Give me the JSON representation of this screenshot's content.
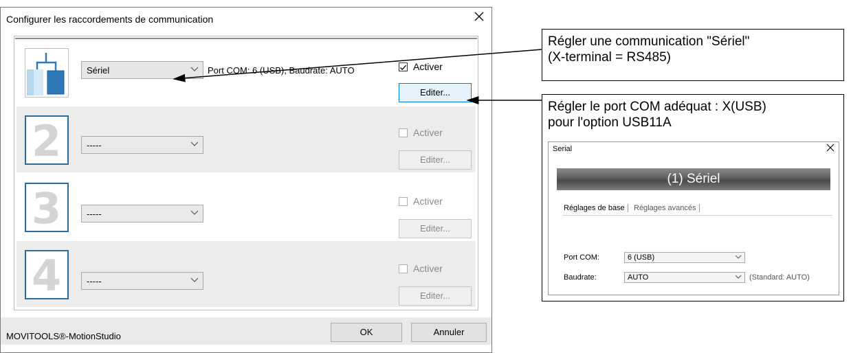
{
  "dialog": {
    "title": "Configurer les raccordements de communication",
    "close_glyph": "×",
    "rows": [
      {
        "number": "1",
        "select_value": "Sériel",
        "port_info": "Port COM: 6 (USB), Baudrate: AUTO",
        "activate_label": "Activer",
        "activate_checked": true,
        "edit_label": "Editer..."
      },
      {
        "number": "2",
        "select_value": "-----",
        "activate_label": "Activer",
        "activate_checked": false,
        "edit_label": "Editer..."
      },
      {
        "number": "3",
        "select_value": "-----",
        "activate_label": "Activer",
        "activate_checked": false,
        "edit_label": "Editer..."
      },
      {
        "number": "4",
        "select_value": "-----",
        "activate_label": "Activer",
        "activate_checked": false,
        "edit_label": "Editer..."
      }
    ],
    "footer": {
      "brand": "MOVITOOLS®-MotionStudio",
      "ok_label": "OK",
      "cancel_label": "Annuler"
    }
  },
  "callouts": {
    "serial": {
      "line1": "Régler une communication \"Sériel\"",
      "line2": "(X-terminal = RS485)"
    },
    "port": {
      "line1": "Régler le port COM adéquat : X(USB)",
      "line2": "pour l'option USB11A"
    }
  },
  "serial_window": {
    "title": "Serial",
    "banner": "(1) Sériel",
    "tabs": [
      "Réglages de base",
      "Réglages avancés"
    ],
    "port_label": "Port COM:",
    "port_value": "6 (USB)",
    "baud_label": "Baudrate:",
    "baud_value": "AUTO",
    "baud_hint": "(Standard: AUTO)"
  },
  "icons": {
    "close": "close-icon",
    "dropdown": "chevron-down-icon",
    "checkbox": "checkmark-icon",
    "network": "network-tree-icon"
  },
  "colors": {
    "accent_blue": "#2c6aa0",
    "button_focus": "#0078d7",
    "row_shade": "#ececec"
  }
}
